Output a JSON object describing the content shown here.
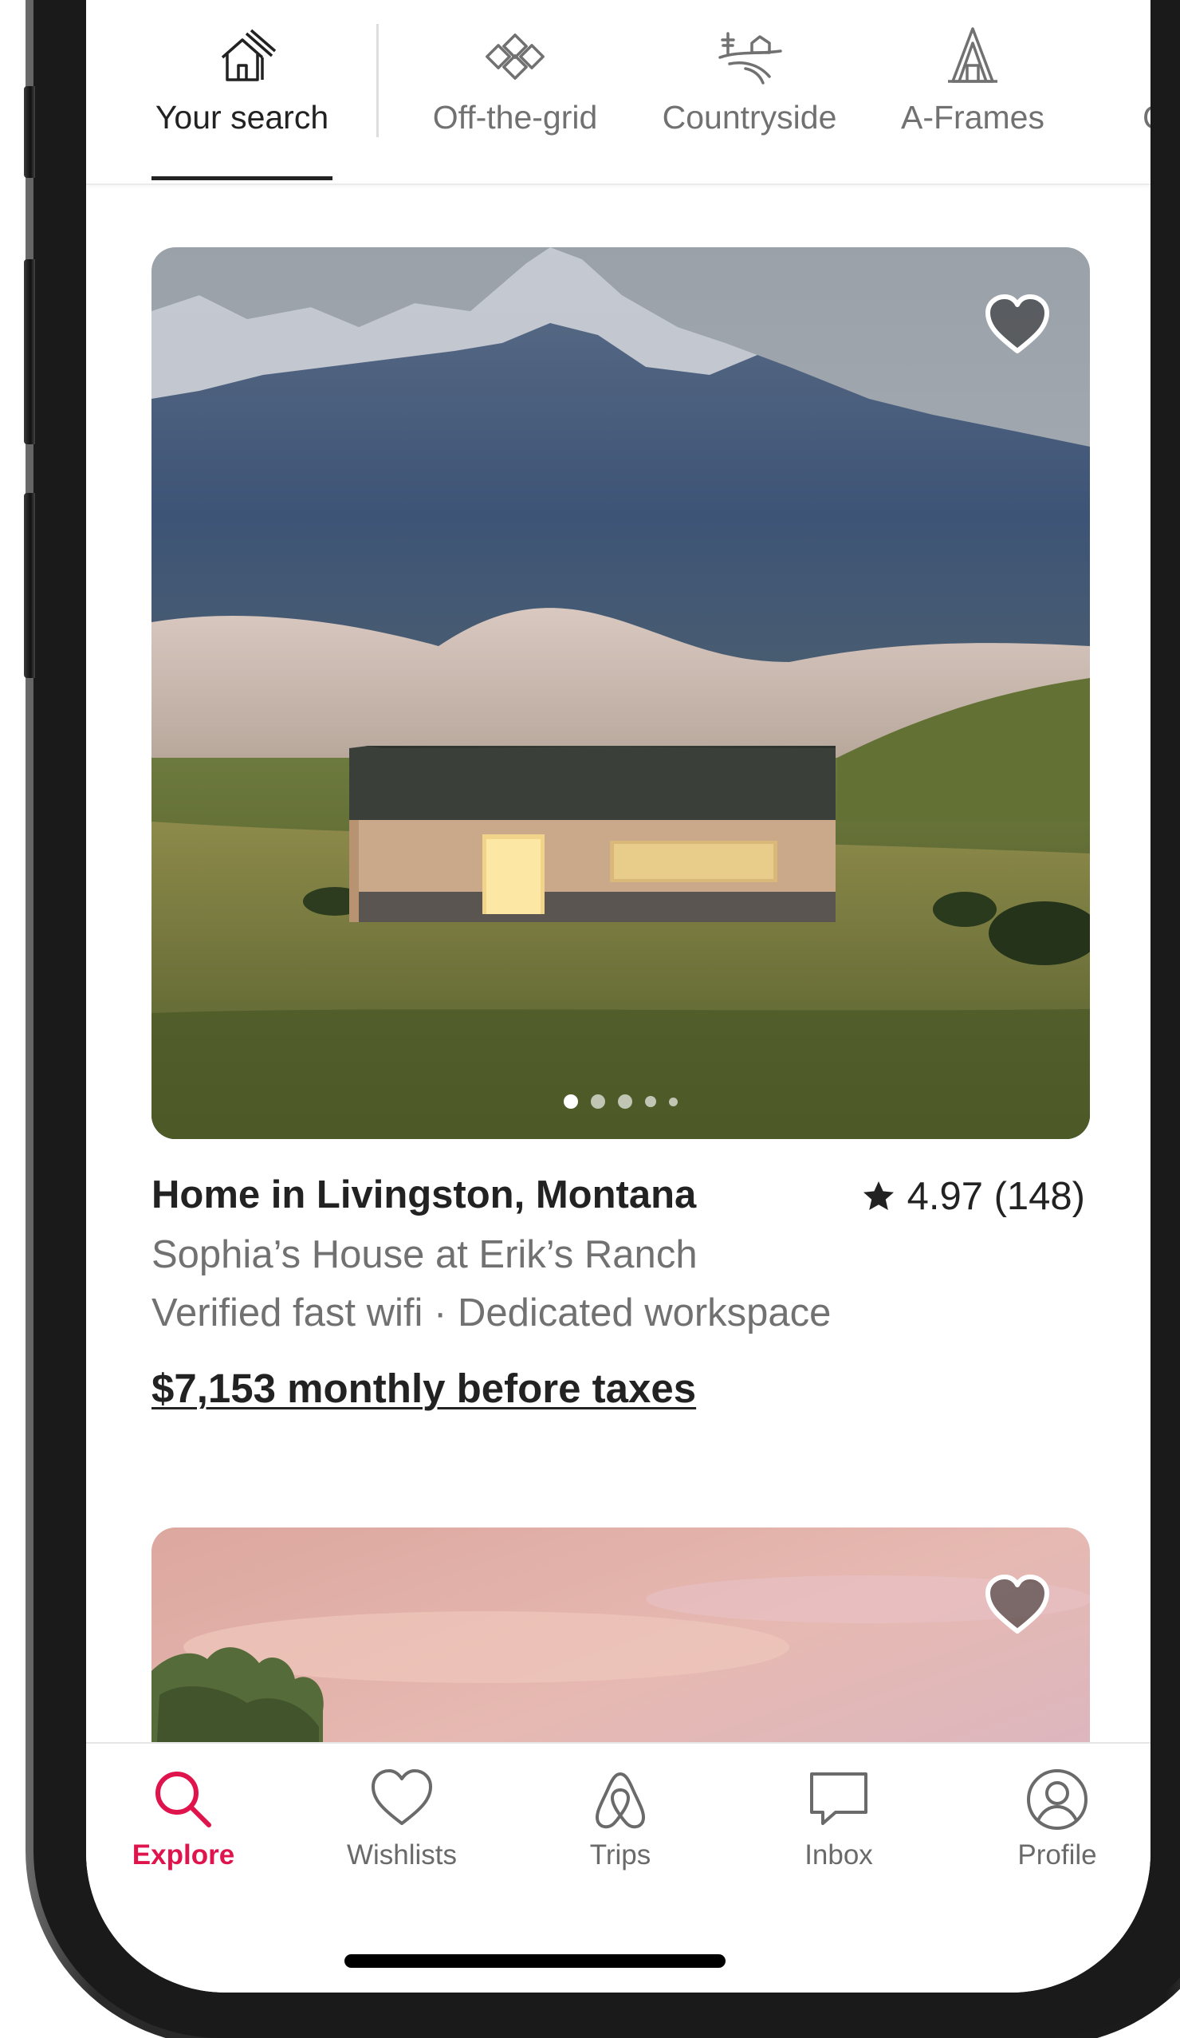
{
  "categories": [
    {
      "label": "Your search",
      "icon": "house-icon",
      "active": true
    },
    {
      "label": "Off-the-grid",
      "icon": "diamonds-icon",
      "active": false
    },
    {
      "label": "Countryside",
      "icon": "countryside-icon",
      "active": false
    },
    {
      "label": "A-Frames",
      "icon": "a-frame-icon",
      "active": false
    },
    {
      "label": "C",
      "icon": "",
      "active": false
    }
  ],
  "listings": [
    {
      "title": "Home in Livingston, Montana",
      "rating": "4.97 (148)",
      "subtitle": "Sophia’s House at Erik’s Ranch",
      "amenities": "Verified fast wifi · Dedicated workspace",
      "price": "$7,153 monthly before taxes",
      "photo_count": 5,
      "active_photo": 1
    }
  ],
  "tabs": [
    {
      "label": "Explore",
      "icon": "search-icon",
      "active": true
    },
    {
      "label": "Wishlists",
      "icon": "heart-icon",
      "active": false
    },
    {
      "label": "Trips",
      "icon": "airbnb-logo-icon",
      "active": false
    },
    {
      "label": "Inbox",
      "icon": "chat-bubble-icon",
      "active": false
    },
    {
      "label": "Profile",
      "icon": "profile-icon",
      "active": false
    }
  ],
  "colors": {
    "accent": "#e0144c",
    "text_primary": "#222222",
    "text_secondary": "#717171",
    "tab_inactive": "#6a6a6a"
  }
}
